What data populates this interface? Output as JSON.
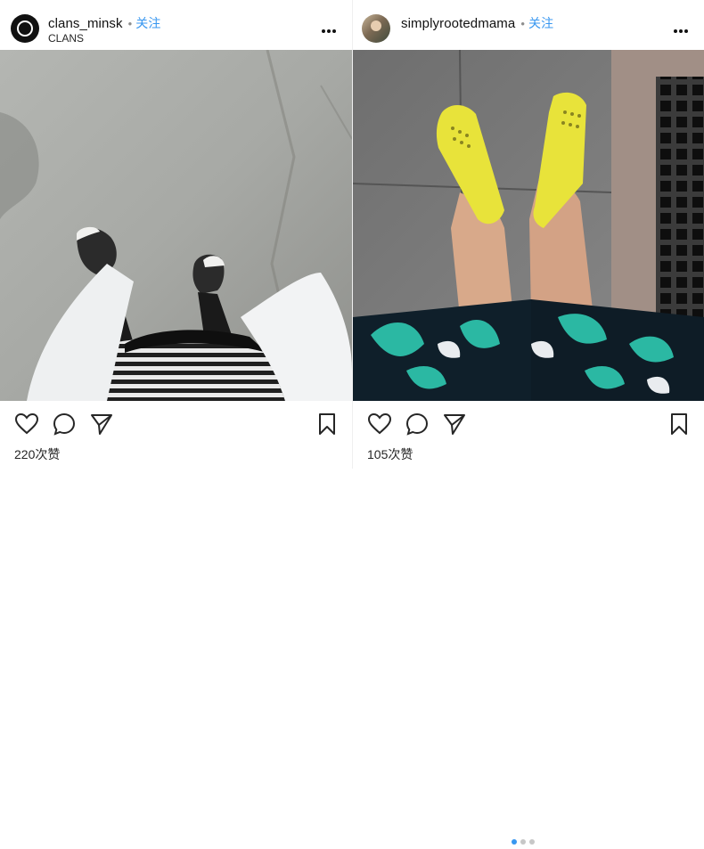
{
  "posts": [
    {
      "username": "clans_minsk",
      "follow_label": "关注",
      "subtitle": "CLANS",
      "likes": "220次赞",
      "icons": {
        "avatar": "clans-logo",
        "more": "more-icon",
        "like": "heart-icon",
        "comment": "comment-icon",
        "share": "share-icon",
        "save": "bookmark-icon"
      }
    },
    {
      "username": "simplyrootedmama",
      "follow_label": "关注",
      "likes": "105次赞",
      "carousel_total": 3,
      "carousel_current": 1,
      "icons": {
        "avatar": "profile-photo",
        "more": "more-icon",
        "like": "heart-icon",
        "comment": "comment-icon",
        "share": "share-icon",
        "save": "bookmark-icon"
      }
    }
  ],
  "colors": {
    "follow": "#3897f0",
    "text": "#262626",
    "divider": "#efefef",
    "carousel_active": "#3897f0",
    "carousel_inactive": "#c7c7c7"
  }
}
